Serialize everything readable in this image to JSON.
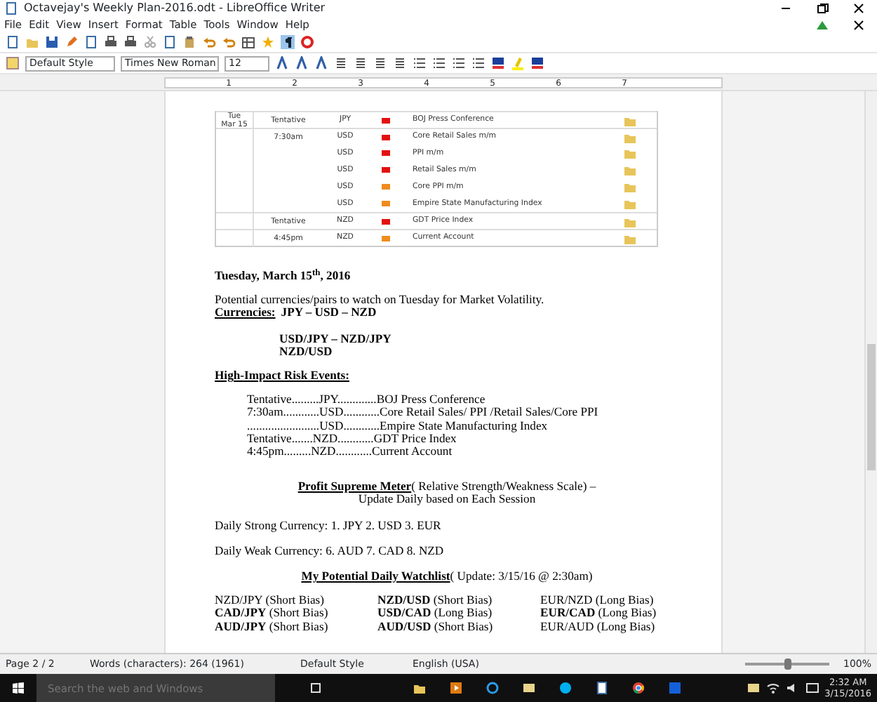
{
  "window": {
    "title": "Octavejay's Weekly Plan-2016.odt - LibreOffice Writer"
  },
  "menu": [
    "File",
    "Edit",
    "View",
    "Insert",
    "Format",
    "Table",
    "Tools",
    "Window",
    "Help"
  ],
  "format_bar": {
    "style": "Default Style",
    "font": "Times New Roman",
    "size": "12"
  },
  "ruler": [
    "1",
    "2",
    "3",
    "4",
    "5",
    "6",
    "7"
  ],
  "calendar": {
    "day": "Tue",
    "date": "Mar 15",
    "rows": [
      {
        "time": "Tentative",
        "currency": "JPY",
        "color": "#e41010",
        "event": "BOJ Press Conference",
        "group_start": true
      },
      {
        "time": "7:30am",
        "currency": "USD",
        "color": "#e41010",
        "event": "Core Retail Sales m/m",
        "group_start": true
      },
      {
        "time": "",
        "currency": "USD",
        "color": "#e41010",
        "event": "PPI m/m",
        "group_start": false
      },
      {
        "time": "",
        "currency": "USD",
        "color": "#e41010",
        "event": "Retail Sales m/m",
        "group_start": false
      },
      {
        "time": "",
        "currency": "USD",
        "color": "#f08c1e",
        "event": "Core PPI m/m",
        "group_start": false
      },
      {
        "time": "",
        "currency": "USD",
        "color": "#f08c1e",
        "event": "Empire State Manufacturing Index",
        "group_start": false
      },
      {
        "time": "Tentative",
        "currency": "NZD",
        "color": "#e41010",
        "event": "GDT Price Index",
        "group_start": true
      },
      {
        "time": "4:45pm",
        "currency": "NZD",
        "color": "#f08c1e",
        "event": "Current Account",
        "group_start": true
      }
    ]
  },
  "document": [
    {
      "kind": "heading",
      "text": "Tuesday, March 15$^{th}$, 2016"
    },
    {
      "kind": "para",
      "text": "Potential currencies/pairs to watch on Tuesday for Market Volatility."
    },
    {
      "kind": "labelled",
      "label": "Currencies:",
      "text": "JPY – USD – NZD"
    },
    {
      "kind": "pairs",
      "lines": [
        "USD/JPY – NZD/JPY",
        "NZD/USD"
      ]
    },
    {
      "kind": "section",
      "text": "High-Impact Risk Events:"
    },
    {
      "kind": "events",
      "lines": [
        "Tentative.........JPY.............BOJ Press Conference",
        "7:30am............USD............Core Retail Sales/ PPI /Retail Sales/Core PPI",
        "........................USD............Empire State Manufacturing Index",
        "Tentative.......NZD............GDT Price Index",
        "4:45pm.........NZD............Current Account"
      ]
    },
    {
      "kind": "centered",
      "label": "Profit Supreme Meter",
      "text": " ( Relative Strength/Weakness Scale) –",
      "line2": "Update Daily based on Each Session"
    },
    {
      "kind": "para",
      "text": "Daily Strong Currency: 1. JPY  2. USD   3. EUR"
    },
    {
      "kind": "para",
      "text": "Daily Weak Currency: 6. AUD  7. CAD  8. NZD"
    },
    {
      "kind": "centered",
      "label": "My Potential Daily Watchlist",
      "text": " ( Update: 3/15/16 @ 2:30am)"
    },
    {
      "kind": "watchlist",
      "rows": [
        [
          "NZD/JPY (Short Bias)",
          "**NZD/USD** (Short Bias)",
          "EUR/NZD (Long Bias)"
        ],
        [
          "**CAD/JPY** (Short Bias)",
          "**USD/CAD** (Long Bias)",
          "**EUR/CAD** (Long Bias)"
        ],
        [
          "**AUD/JPY** (Short Bias)",
          "**AUD/USD** (Short Bias)",
          "EUR/AUD (Long Bias)"
        ]
      ]
    }
  ],
  "status_bar": {
    "page": "Page 2 / 2",
    "words": "Words (characters): 264 (1961)",
    "style": "Default Style",
    "language": "English (USA)",
    "zoom": "100%",
    "level": 0.5
  },
  "taskbar": {
    "search_placeholder": "Search the web and Windows",
    "time": "2:32 AM",
    "date": "3/15/2016"
  }
}
